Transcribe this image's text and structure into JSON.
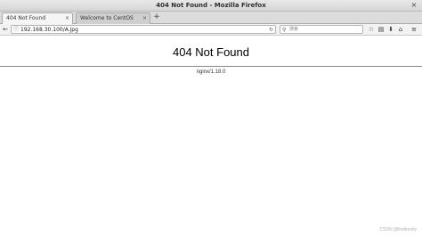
{
  "window": {
    "title": "404 Not Found - Mozilla Firefox",
    "close_glyph": "×"
  },
  "tabs": [
    {
      "label": "404 Not Found",
      "active": true
    },
    {
      "label": "Welcome to CentOS",
      "active": false
    }
  ],
  "tab_close_glyph": "×",
  "new_tab_glyph": "+",
  "nav": {
    "back_glyph": "←",
    "info_glyph": "ⓘ",
    "url": "192.168.30.100/A.jpg",
    "reload_glyph": "↻",
    "search_glyph": "⚲",
    "search_placeholder": "搜索",
    "bookmark_glyph": "☆",
    "reader_glyph": "▤",
    "download_glyph": "⬇",
    "home_glyph": "⌂",
    "menu_glyph": "≡"
  },
  "page": {
    "heading": "404 Not Found",
    "server": "nginx/1.18.0"
  },
  "watermark": "CSDN @lindirectly"
}
